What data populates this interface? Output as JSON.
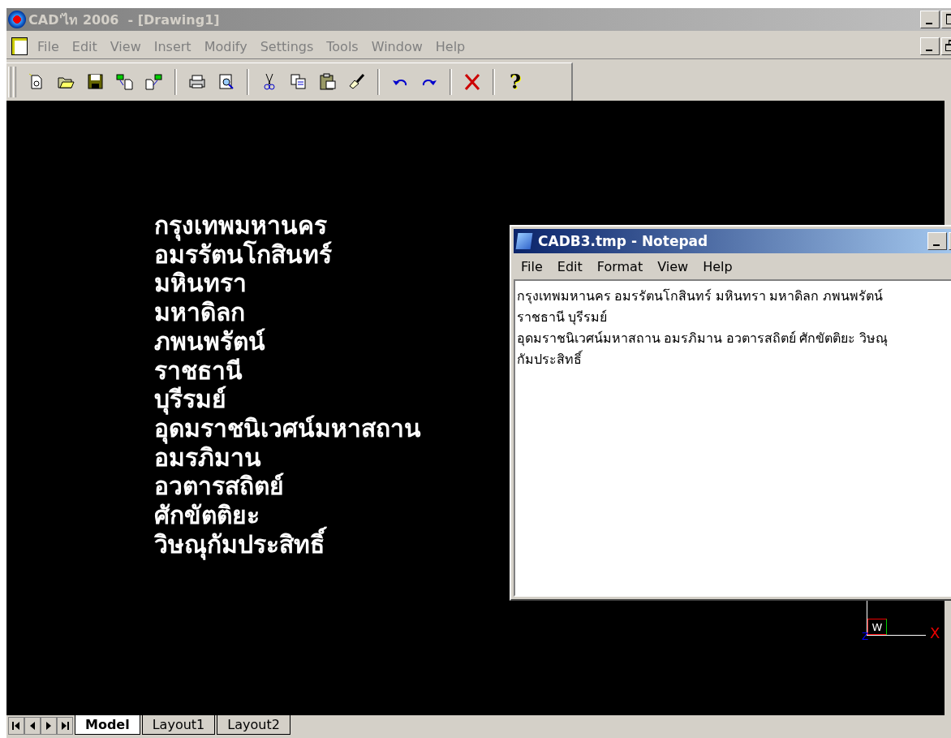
{
  "window": {
    "title": "CAD'ไท 2006  - [Drawing1]",
    "active": false
  },
  "menu": [
    {
      "label": "File",
      "disabled": true
    },
    {
      "label": "Edit",
      "disabled": true
    },
    {
      "label": "View",
      "disabled": true
    },
    {
      "label": "Insert",
      "disabled": true
    },
    {
      "label": "Modify",
      "disabled": true
    },
    {
      "label": "Settings",
      "disabled": true
    },
    {
      "label": "Tools",
      "disabled": true
    },
    {
      "label": "Window",
      "disabled": true
    },
    {
      "label": "Help",
      "disabled": true
    }
  ],
  "toolbar": [
    {
      "kind": "new"
    },
    {
      "kind": "open"
    },
    {
      "kind": "save"
    },
    {
      "kind": "import"
    },
    {
      "kind": "export"
    },
    {
      "kind": "sep"
    },
    {
      "kind": "print"
    },
    {
      "kind": "preview"
    },
    {
      "kind": "sep"
    },
    {
      "kind": "cut"
    },
    {
      "kind": "copy"
    },
    {
      "kind": "paste"
    },
    {
      "kind": "brush"
    },
    {
      "kind": "sep"
    },
    {
      "kind": "undo"
    },
    {
      "kind": "redo"
    },
    {
      "kind": "sep"
    },
    {
      "kind": "delete"
    },
    {
      "kind": "sep"
    },
    {
      "kind": "help",
      "glyph": "?"
    }
  ],
  "drawing": {
    "texts": [
      "กรุงเทพมหานคร",
      "อมรรัตนโกสินทร์",
      "มหินทรา",
      "มหาดิลก",
      "ภพนพรัตน์",
      "ราชธานี",
      "บุรีรมย์",
      "อุดมราชนิเวศน์มหาสถาน",
      "อมรภิมาน",
      "อวตารสถิตย์",
      "ศักขัตติยะ",
      "วิษณุกัมประสิทธิ์"
    ],
    "ucs": {
      "box_label": "W",
      "x_label": "X",
      "z_label": "Z"
    }
  },
  "layout_tabs": [
    {
      "label": "Model",
      "selected": true
    },
    {
      "label": "Layout1",
      "selected": false
    },
    {
      "label": "Layout2",
      "selected": false
    }
  ],
  "notepad": {
    "title": "CADB3.tmp - Notepad",
    "active": true,
    "menu": [
      "File",
      "Edit",
      "Format",
      "View",
      "Help"
    ],
    "lines": [
      "กรุงเทพมหานคร อมรรัตนโกสินทร์ มหินทรา มหาดิลก ภพนพรัตน์",
      "ราชธานี บุรีรมย์",
      "อุดมราชนิเวศน์มหาสถาน อมรภิมาน อวตารสถิตย์ ศักขัตติยะ วิษณุ",
      "กัมประสิทธิ์"
    ]
  }
}
